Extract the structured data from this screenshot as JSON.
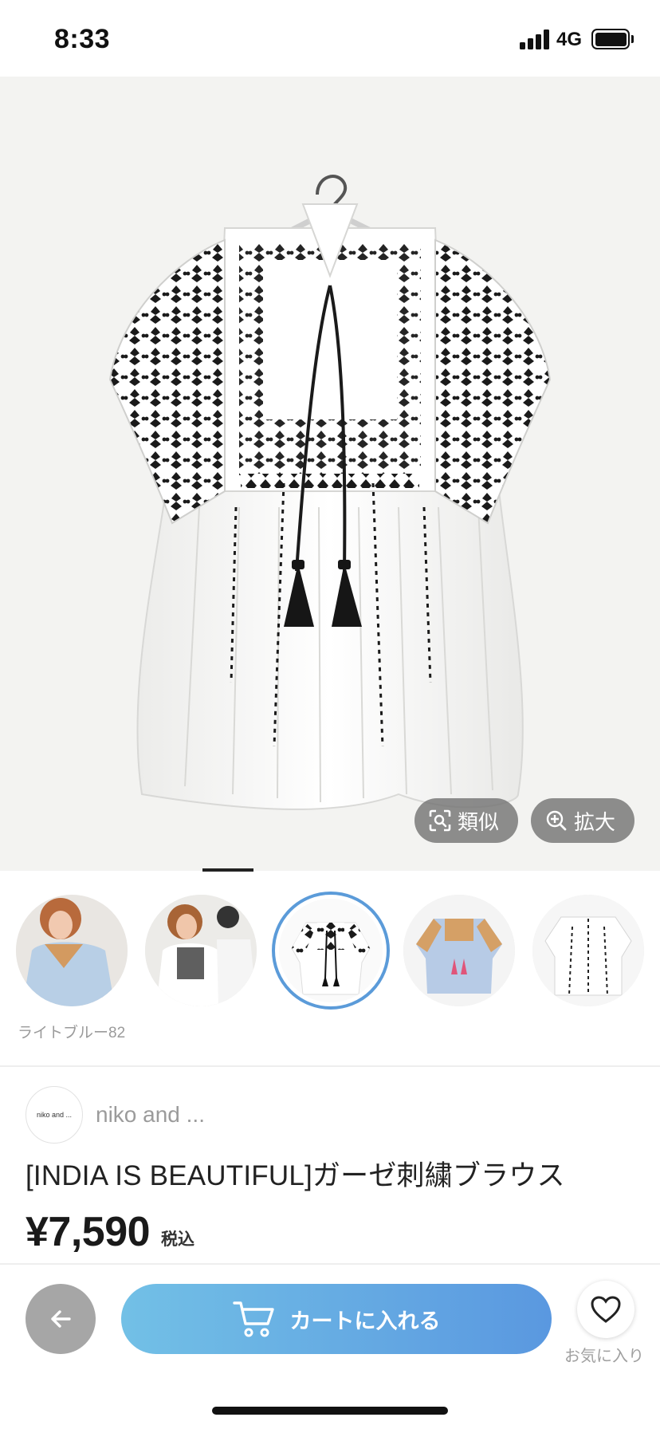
{
  "status_bar": {
    "time": "8:33",
    "network": "4G"
  },
  "hero": {
    "similar_label": "類似",
    "zoom_label": "拡大",
    "icons": {
      "similar": "scan-icon",
      "zoom": "zoom-in-icon"
    }
  },
  "thumbnails": {
    "items": [
      {
        "name": "thumb-model-blue-1",
        "selected": false
      },
      {
        "name": "thumb-model-white",
        "selected": false
      },
      {
        "name": "thumb-white-blouse",
        "selected": true
      },
      {
        "name": "thumb-light-blue-blouse",
        "selected": false
      },
      {
        "name": "thumb-white-blouse-back",
        "selected": false
      }
    ],
    "caption": "ライトブルー82"
  },
  "product": {
    "brand_logo_text": "niko and ...",
    "brand_name": "niko and ...",
    "title": "[INDIA IS BEAUTIFUL]ガーゼ刺繍ブラウス",
    "price": "¥7,590",
    "tax_label": "税込"
  },
  "actions": {
    "cart_label": "カートに入れる",
    "favorite_label": "お気に入り",
    "icons": {
      "back": "arrow-left-icon",
      "cart": "cart-icon",
      "favorite": "heart-icon"
    }
  },
  "colors": {
    "accent": "#5b9bd9",
    "cart_gradient_start": "#72c0e6",
    "cart_gradient_end": "#5a98e0",
    "back_button": "#a6a6a6"
  }
}
